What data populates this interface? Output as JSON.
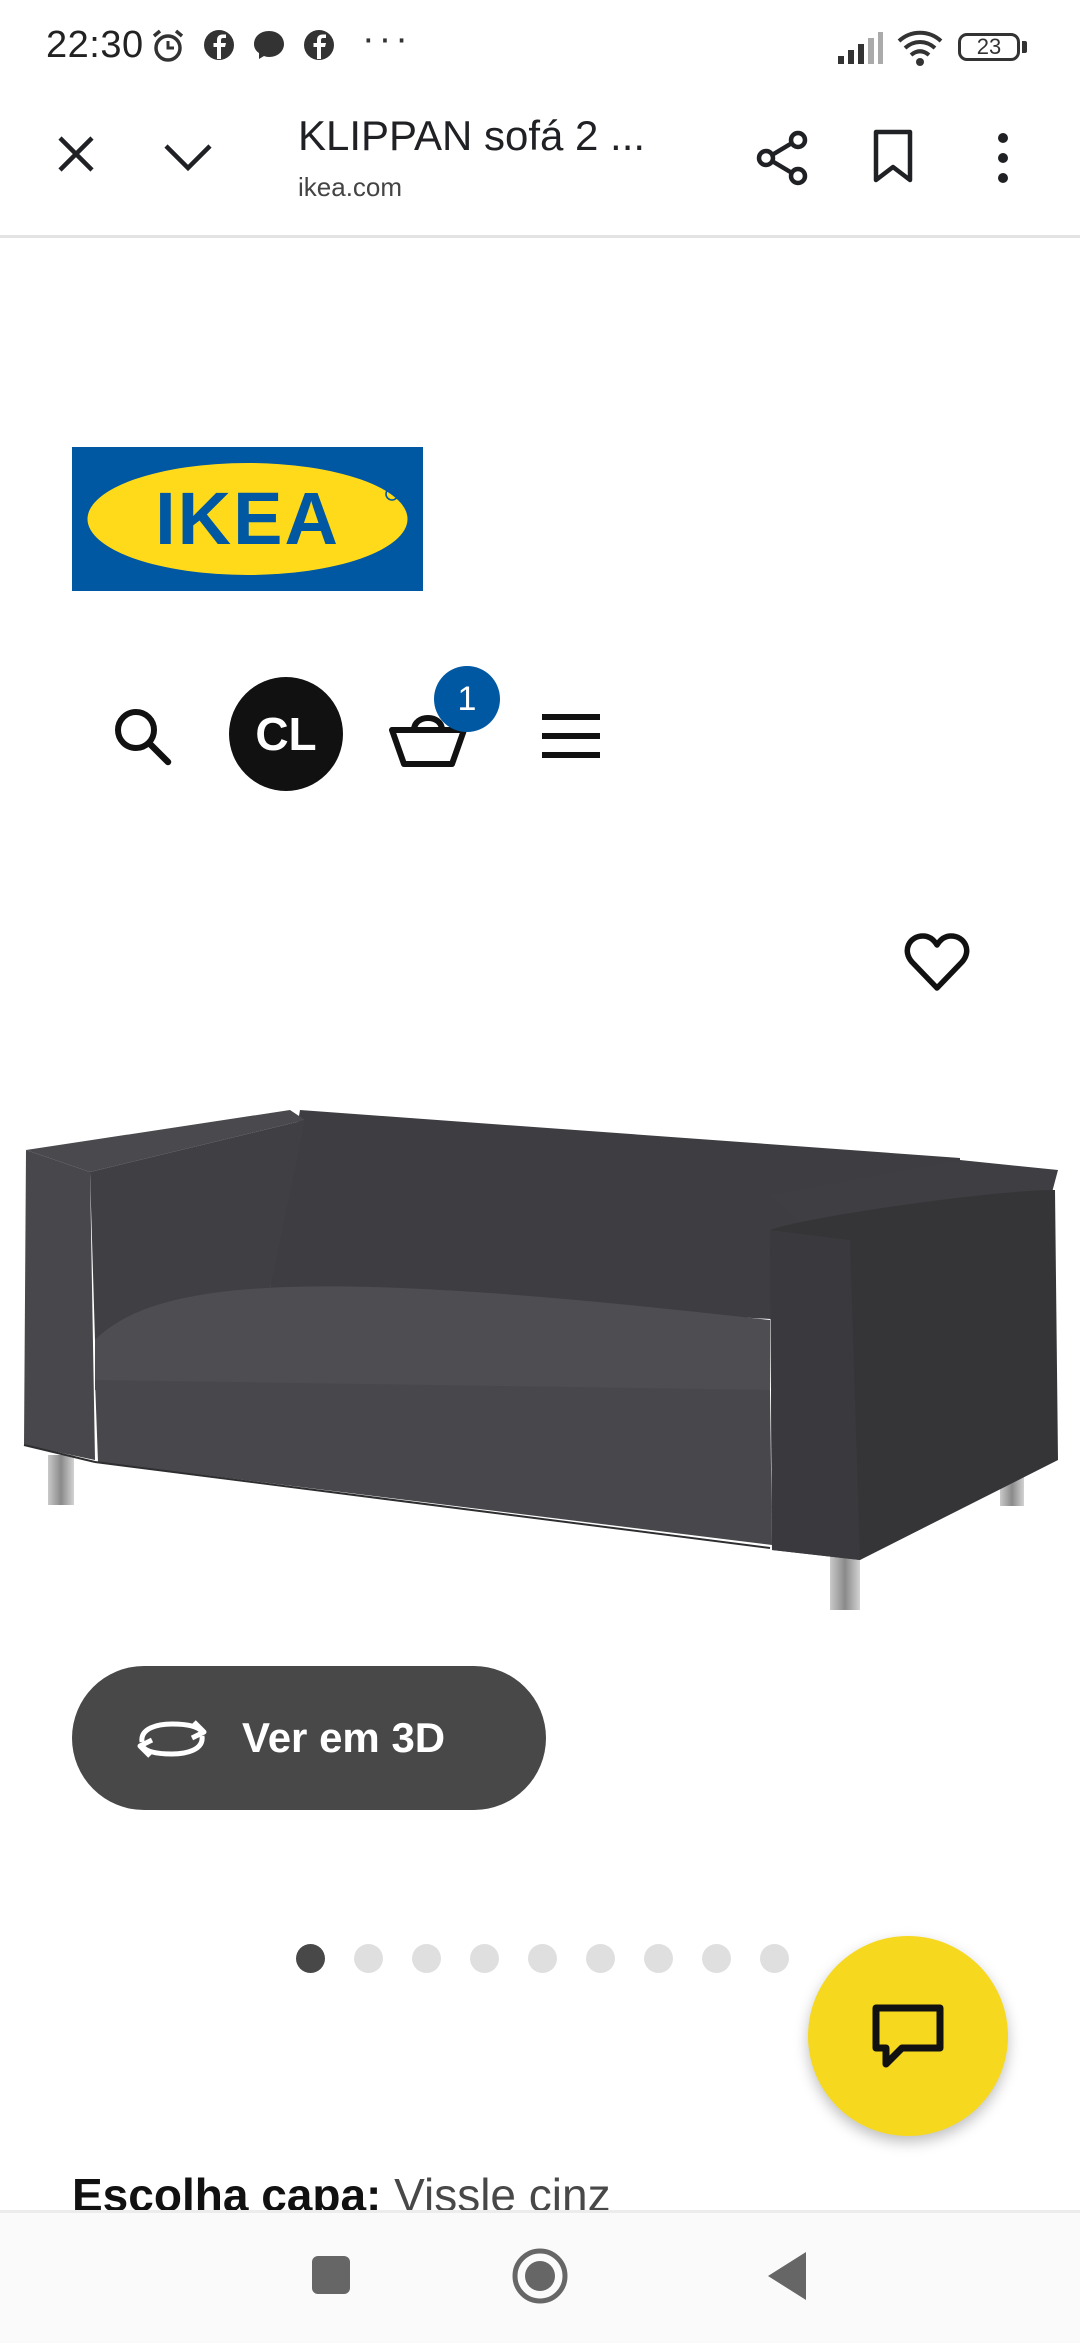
{
  "status_bar": {
    "time": "22:30",
    "icons": [
      "alarm-icon",
      "facebook-icon",
      "messenger-icon",
      "facebook-icon"
    ],
    "more": "···",
    "battery": "23"
  },
  "toolbar": {
    "title": "KLIPPAN sofá 2 ...",
    "url": "ikea.com"
  },
  "logo": {
    "text": "IKEA",
    "blue": "#0058a3",
    "yellow": "#ffda1a"
  },
  "header": {
    "avatar_initials": "CL",
    "cart_count": "1"
  },
  "product": {
    "view_3d_label": "Ver em 3D",
    "image_count": 9,
    "active_image": 1
  },
  "options": {
    "cover_label": "Escolha capa:",
    "cover_value": "Vissle cinz"
  },
  "colors": {
    "accent_dark": "#484848",
    "chat_yellow": "#f6d81f",
    "badge_blue": "#0058a3"
  }
}
